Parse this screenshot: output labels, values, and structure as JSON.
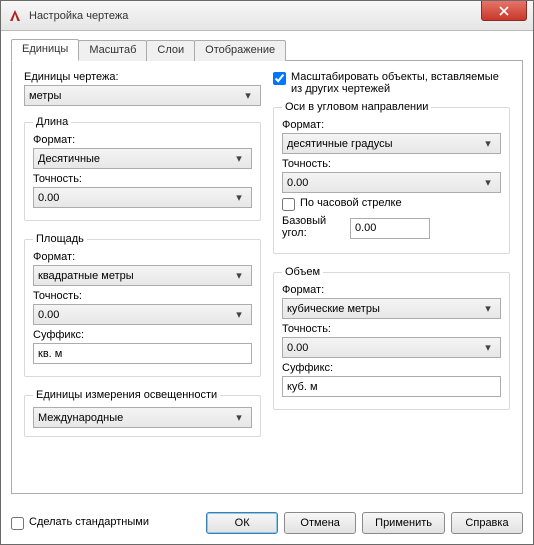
{
  "window": {
    "title": "Настройка чертежа"
  },
  "tabs": {
    "units": "Единицы",
    "scale": "Масштаб",
    "layers": "Слои",
    "display": "Отображение"
  },
  "drawing_units": {
    "label": "Единицы чертежа:",
    "value": "метры"
  },
  "length": {
    "legend": "Длина",
    "format_label": "Формат:",
    "format_value": "Десятичные",
    "precision_label": "Точность:",
    "precision_value": "0.00"
  },
  "area": {
    "legend": "Площадь",
    "format_label": "Формат:",
    "format_value": "квадратные метры",
    "precision_label": "Точность:",
    "precision_value": "0.00",
    "suffix_label": "Суффикс:",
    "suffix_value": "кв. м"
  },
  "illum": {
    "legend": "Единицы измерения освещенности",
    "value": "Международные"
  },
  "scale_check": {
    "label": "Масштабировать объекты, вставляемые из других чертежей",
    "checked": true
  },
  "angle": {
    "legend": "Оси в угловом направлении",
    "format_label": "Формат:",
    "format_value": "десятичные градусы",
    "precision_label": "Точность:",
    "precision_value": "0.00",
    "clockwise_label": "По часовой стрелке",
    "clockwise_checked": false,
    "base_label": "Базовый угол:",
    "base_value": "0.00"
  },
  "volume": {
    "legend": "Объем",
    "format_label": "Формат:",
    "format_value": "кубические метры",
    "precision_label": "Точность:",
    "precision_value": "0.00",
    "suffix_label": "Суффикс:",
    "suffix_value": "куб. м"
  },
  "footer": {
    "make_default": "Сделать стандартными",
    "ok": "ОК",
    "cancel": "Отмена",
    "apply": "Применить",
    "help": "Справка"
  }
}
